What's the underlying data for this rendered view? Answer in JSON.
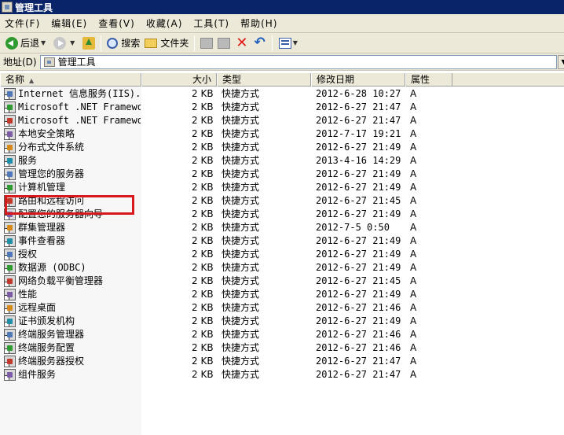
{
  "window": {
    "title": "管理工具"
  },
  "menu": [
    "文件(F)",
    "编辑(E)",
    "查看(V)",
    "收藏(A)",
    "工具(T)",
    "帮助(H)"
  ],
  "toolbar": {
    "back": "后退",
    "search": "搜索",
    "folders": "文件夹"
  },
  "address": {
    "label": "地址(D)",
    "value": "管理工具"
  },
  "columns": [
    "名称",
    "大小",
    "类型",
    "修改日期",
    "属性"
  ],
  "rows": [
    {
      "name": "Internet 信息服务(IIS)...",
      "size": "2 KB",
      "type": "快捷方式",
      "date": "2012-6-28 10:27",
      "attr": "A"
    },
    {
      "name": "Microsoft .NET Framewor...",
      "size": "2 KB",
      "type": "快捷方式",
      "date": "2012-6-27 21:47",
      "attr": "A"
    },
    {
      "name": "Microsoft .NET Framewor...",
      "size": "2 KB",
      "type": "快捷方式",
      "date": "2012-6-27 21:47",
      "attr": "A"
    },
    {
      "name": "本地安全策略",
      "size": "2 KB",
      "type": "快捷方式",
      "date": "2012-7-17 19:21",
      "attr": "A"
    },
    {
      "name": "分布式文件系统",
      "size": "2 KB",
      "type": "快捷方式",
      "date": "2012-6-27 21:49",
      "attr": "A"
    },
    {
      "name": "服务",
      "size": "2 KB",
      "type": "快捷方式",
      "date": "2013-4-16 14:29",
      "attr": "A"
    },
    {
      "name": "管理您的服务器",
      "size": "2 KB",
      "type": "快捷方式",
      "date": "2012-6-27 21:49",
      "attr": "A"
    },
    {
      "name": "计算机管理",
      "size": "2 KB",
      "type": "快捷方式",
      "date": "2012-6-27 21:49",
      "attr": "A"
    },
    {
      "name": "路由和远程访问",
      "size": "2 KB",
      "type": "快捷方式",
      "date": "2012-6-27 21:45",
      "attr": "A"
    },
    {
      "name": "配置您的服务器向导",
      "size": "2 KB",
      "type": "快捷方式",
      "date": "2012-6-27 21:49",
      "attr": "A"
    },
    {
      "name": "群集管理器",
      "size": "2 KB",
      "type": "快捷方式",
      "date": "2012-7-5 0:50",
      "attr": "A"
    },
    {
      "name": "事件查看器",
      "size": "2 KB",
      "type": "快捷方式",
      "date": "2012-6-27 21:49",
      "attr": "A"
    },
    {
      "name": "授权",
      "size": "2 KB",
      "type": "快捷方式",
      "date": "2012-6-27 21:49",
      "attr": "A"
    },
    {
      "name": "数据源 (ODBC)",
      "size": "2 KB",
      "type": "快捷方式",
      "date": "2012-6-27 21:49",
      "attr": "A"
    },
    {
      "name": "网络负载平衡管理器",
      "size": "2 KB",
      "type": "快捷方式",
      "date": "2012-6-27 21:45",
      "attr": "A"
    },
    {
      "name": "性能",
      "size": "2 KB",
      "type": "快捷方式",
      "date": "2012-6-27 21:49",
      "attr": "A"
    },
    {
      "name": "远程桌面",
      "size": "2 KB",
      "type": "快捷方式",
      "date": "2012-6-27 21:46",
      "attr": "A"
    },
    {
      "name": "证书颁发机构",
      "size": "2 KB",
      "type": "快捷方式",
      "date": "2012-6-27 21:49",
      "attr": "A"
    },
    {
      "name": "终端服务管理器",
      "size": "2 KB",
      "type": "快捷方式",
      "date": "2012-6-27 21:46",
      "attr": "A"
    },
    {
      "name": "终端服务配置",
      "size": "2 KB",
      "type": "快捷方式",
      "date": "2012-6-27 21:46",
      "attr": "A"
    },
    {
      "name": "终端服务器授权",
      "size": "2 KB",
      "type": "快捷方式",
      "date": "2012-6-27 21:47",
      "attr": "A"
    },
    {
      "name": "组件服务",
      "size": "2 KB",
      "type": "快捷方式",
      "date": "2012-6-27 21:47",
      "attr": "A"
    }
  ],
  "colors": {
    "titlebar": "#0a246a",
    "highlight": "#d7191c"
  }
}
